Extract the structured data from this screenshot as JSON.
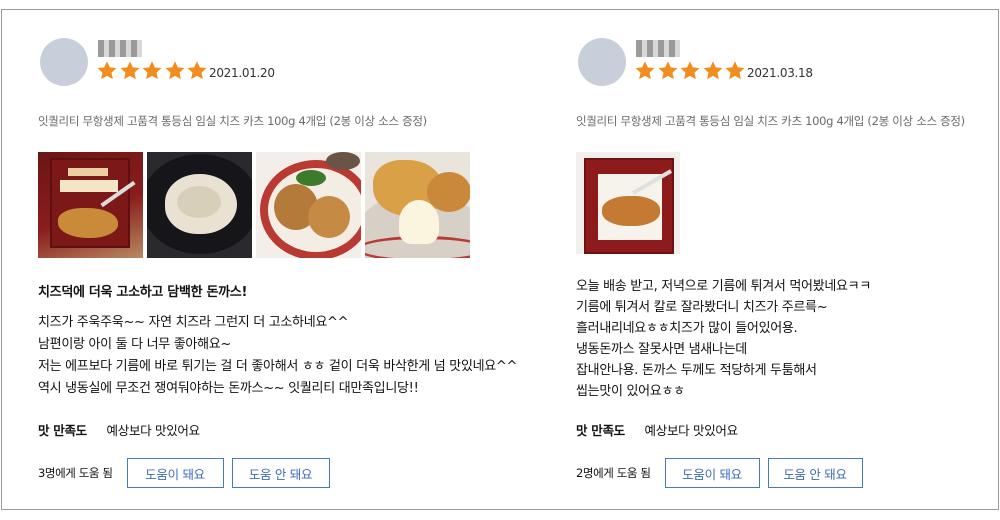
{
  "reviews": [
    {
      "rating": 5,
      "date": "2021.01.20",
      "product": "잇퀄리티 무항생제 고품격 통등심 임실 치즈 카츠 100g 4개입 (2봉 이상 소스 증정)",
      "photos": [
        "photo-package-fork",
        "photo-cutlet-pan",
        "photo-cutlets-plate",
        "photo-cheese-cutlet"
      ],
      "title": "치즈덕에 더욱 고소하고 담백한 돈까스!",
      "lines": [
        "치즈가 주욱주욱~~ 자연 치즈라 그런지 더 고소하네요^^",
        "남편이랑 아이 둘 다 너무 좋아해요~",
        "저는 에프보다 기름에 바로 튀기는 걸 더 좋아해서 ㅎㅎ 겉이 더욱 바삭한게 넘 맛있네요^^",
        "역시 냉동실에 무조건 쟁여둬야하는 돈까스~~ 잇퀄리티 대만족입니당!!"
      ],
      "taste_label": "맛 만족도",
      "taste_value": "예상보다 맛있어요",
      "helpful_count": "3명에게 도움 됨",
      "helpful_yes": "도움이 돼요",
      "helpful_no": "도움 안 돼요"
    },
    {
      "rating": 5,
      "date": "2021.03.18",
      "product": "잇퀄리티 무항생제 고품격 통등심 임실 치즈 카츠 100g 4개입 (2봉 이상 소스 증정)",
      "photos": [
        "photo-package-fork"
      ],
      "lines": [
        "오늘 배송 받고, 저녁으로 기름에 튀겨서 먹어봤네요ㅋㅋ",
        "기름에 튀겨서 칼로 잘라봤더니 치즈가 주르륵~",
        "흘러내리네요ㅎㅎ치즈가 많이 들어있어용.",
        "냉동돈까스 잘못사면 냄새나는데",
        "잡내안나용. 돈까스 두께도 적당하게 두툼해서",
        "씹는맛이 있어요ㅎㅎ"
      ],
      "taste_label": "맛 만족도",
      "taste_value": "예상보다 맛있어요",
      "helpful_count": "2명에게 도움 됨",
      "helpful_yes": "도움이 돼요",
      "helpful_no": "도움 안 돼요"
    }
  ],
  "colors": {
    "star": "#f28c1c",
    "button": "#3c6bc0",
    "avatar": "#c8cfdb"
  },
  "icons": {
    "star": "star-icon"
  }
}
